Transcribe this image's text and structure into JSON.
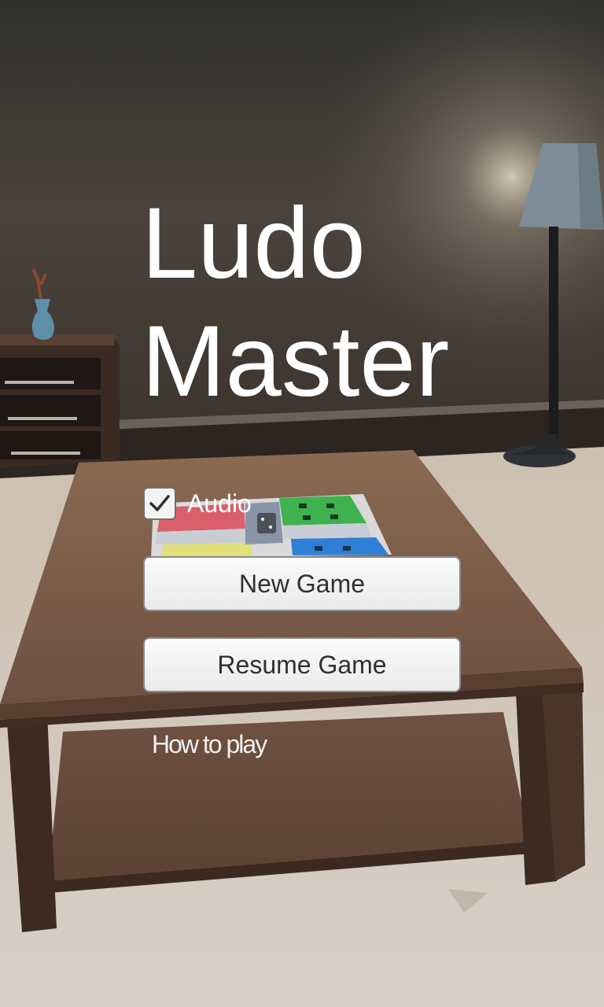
{
  "title": {
    "line1": "Ludo",
    "line2": "Master"
  },
  "audio": {
    "label": "Audio",
    "checked": true
  },
  "buttons": {
    "new_game": "New Game",
    "resume_game": "Resume Game"
  },
  "links": {
    "how_to_play": "How to play"
  },
  "icons": {
    "checkbox_mark": "checkmark-icon"
  },
  "colors": {
    "title": "#ffffff",
    "button_bg": "#f2f2f2",
    "button_text": "#303030",
    "board_red": "#d9606a",
    "board_green": "#3fb24f",
    "board_blue": "#2f7fd6",
    "board_yellow": "#e2e07a"
  }
}
